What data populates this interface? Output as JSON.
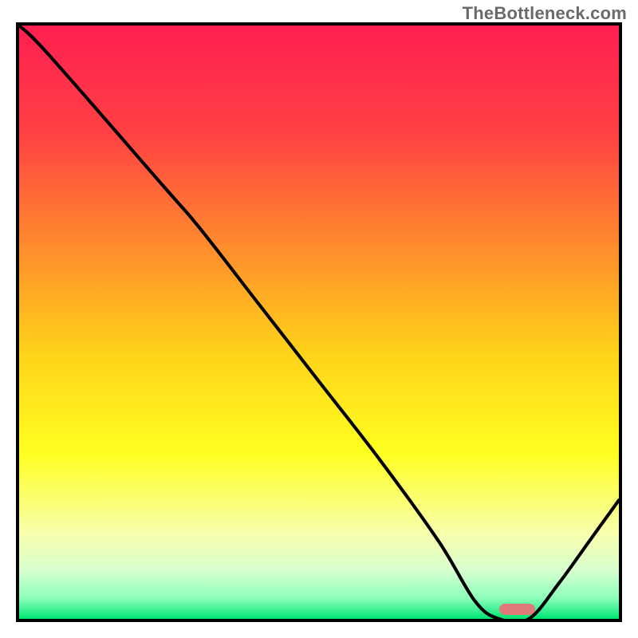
{
  "watermark": "TheBottleneck.com",
  "chart_data": {
    "type": "line",
    "title": "",
    "xlabel": "",
    "ylabel": "",
    "xlim": [
      0,
      100
    ],
    "ylim": [
      0,
      100
    ],
    "grid": false,
    "legend": false,
    "series": [
      {
        "name": "bottleneck-curve",
        "x": [
          0,
          5,
          24,
          30,
          40,
          50,
          60,
          70,
          76,
          80,
          85,
          90,
          95,
          100
        ],
        "values": [
          100,
          95,
          73,
          66,
          53,
          40,
          27,
          13,
          3,
          0,
          0,
          6,
          13,
          20
        ]
      }
    ],
    "marker": {
      "name": "optimal-range",
      "x_start": 80,
      "x_end": 86,
      "y": 0.5,
      "color": "#e07a78"
    },
    "background_gradient": {
      "type": "vertical",
      "stops": [
        {
          "pos": 0.0,
          "color": "#ff1f52"
        },
        {
          "pos": 0.18,
          "color": "#ff4043"
        },
        {
          "pos": 0.38,
          "color": "#ff8f2c"
        },
        {
          "pos": 0.55,
          "color": "#ffd21a"
        },
        {
          "pos": 0.72,
          "color": "#ffff20"
        },
        {
          "pos": 0.86,
          "color": "#f7ffb0"
        },
        {
          "pos": 0.92,
          "color": "#d6ffcf"
        },
        {
          "pos": 0.965,
          "color": "#8cffba"
        },
        {
          "pos": 1.0,
          "color": "#00e572"
        }
      ]
    }
  }
}
